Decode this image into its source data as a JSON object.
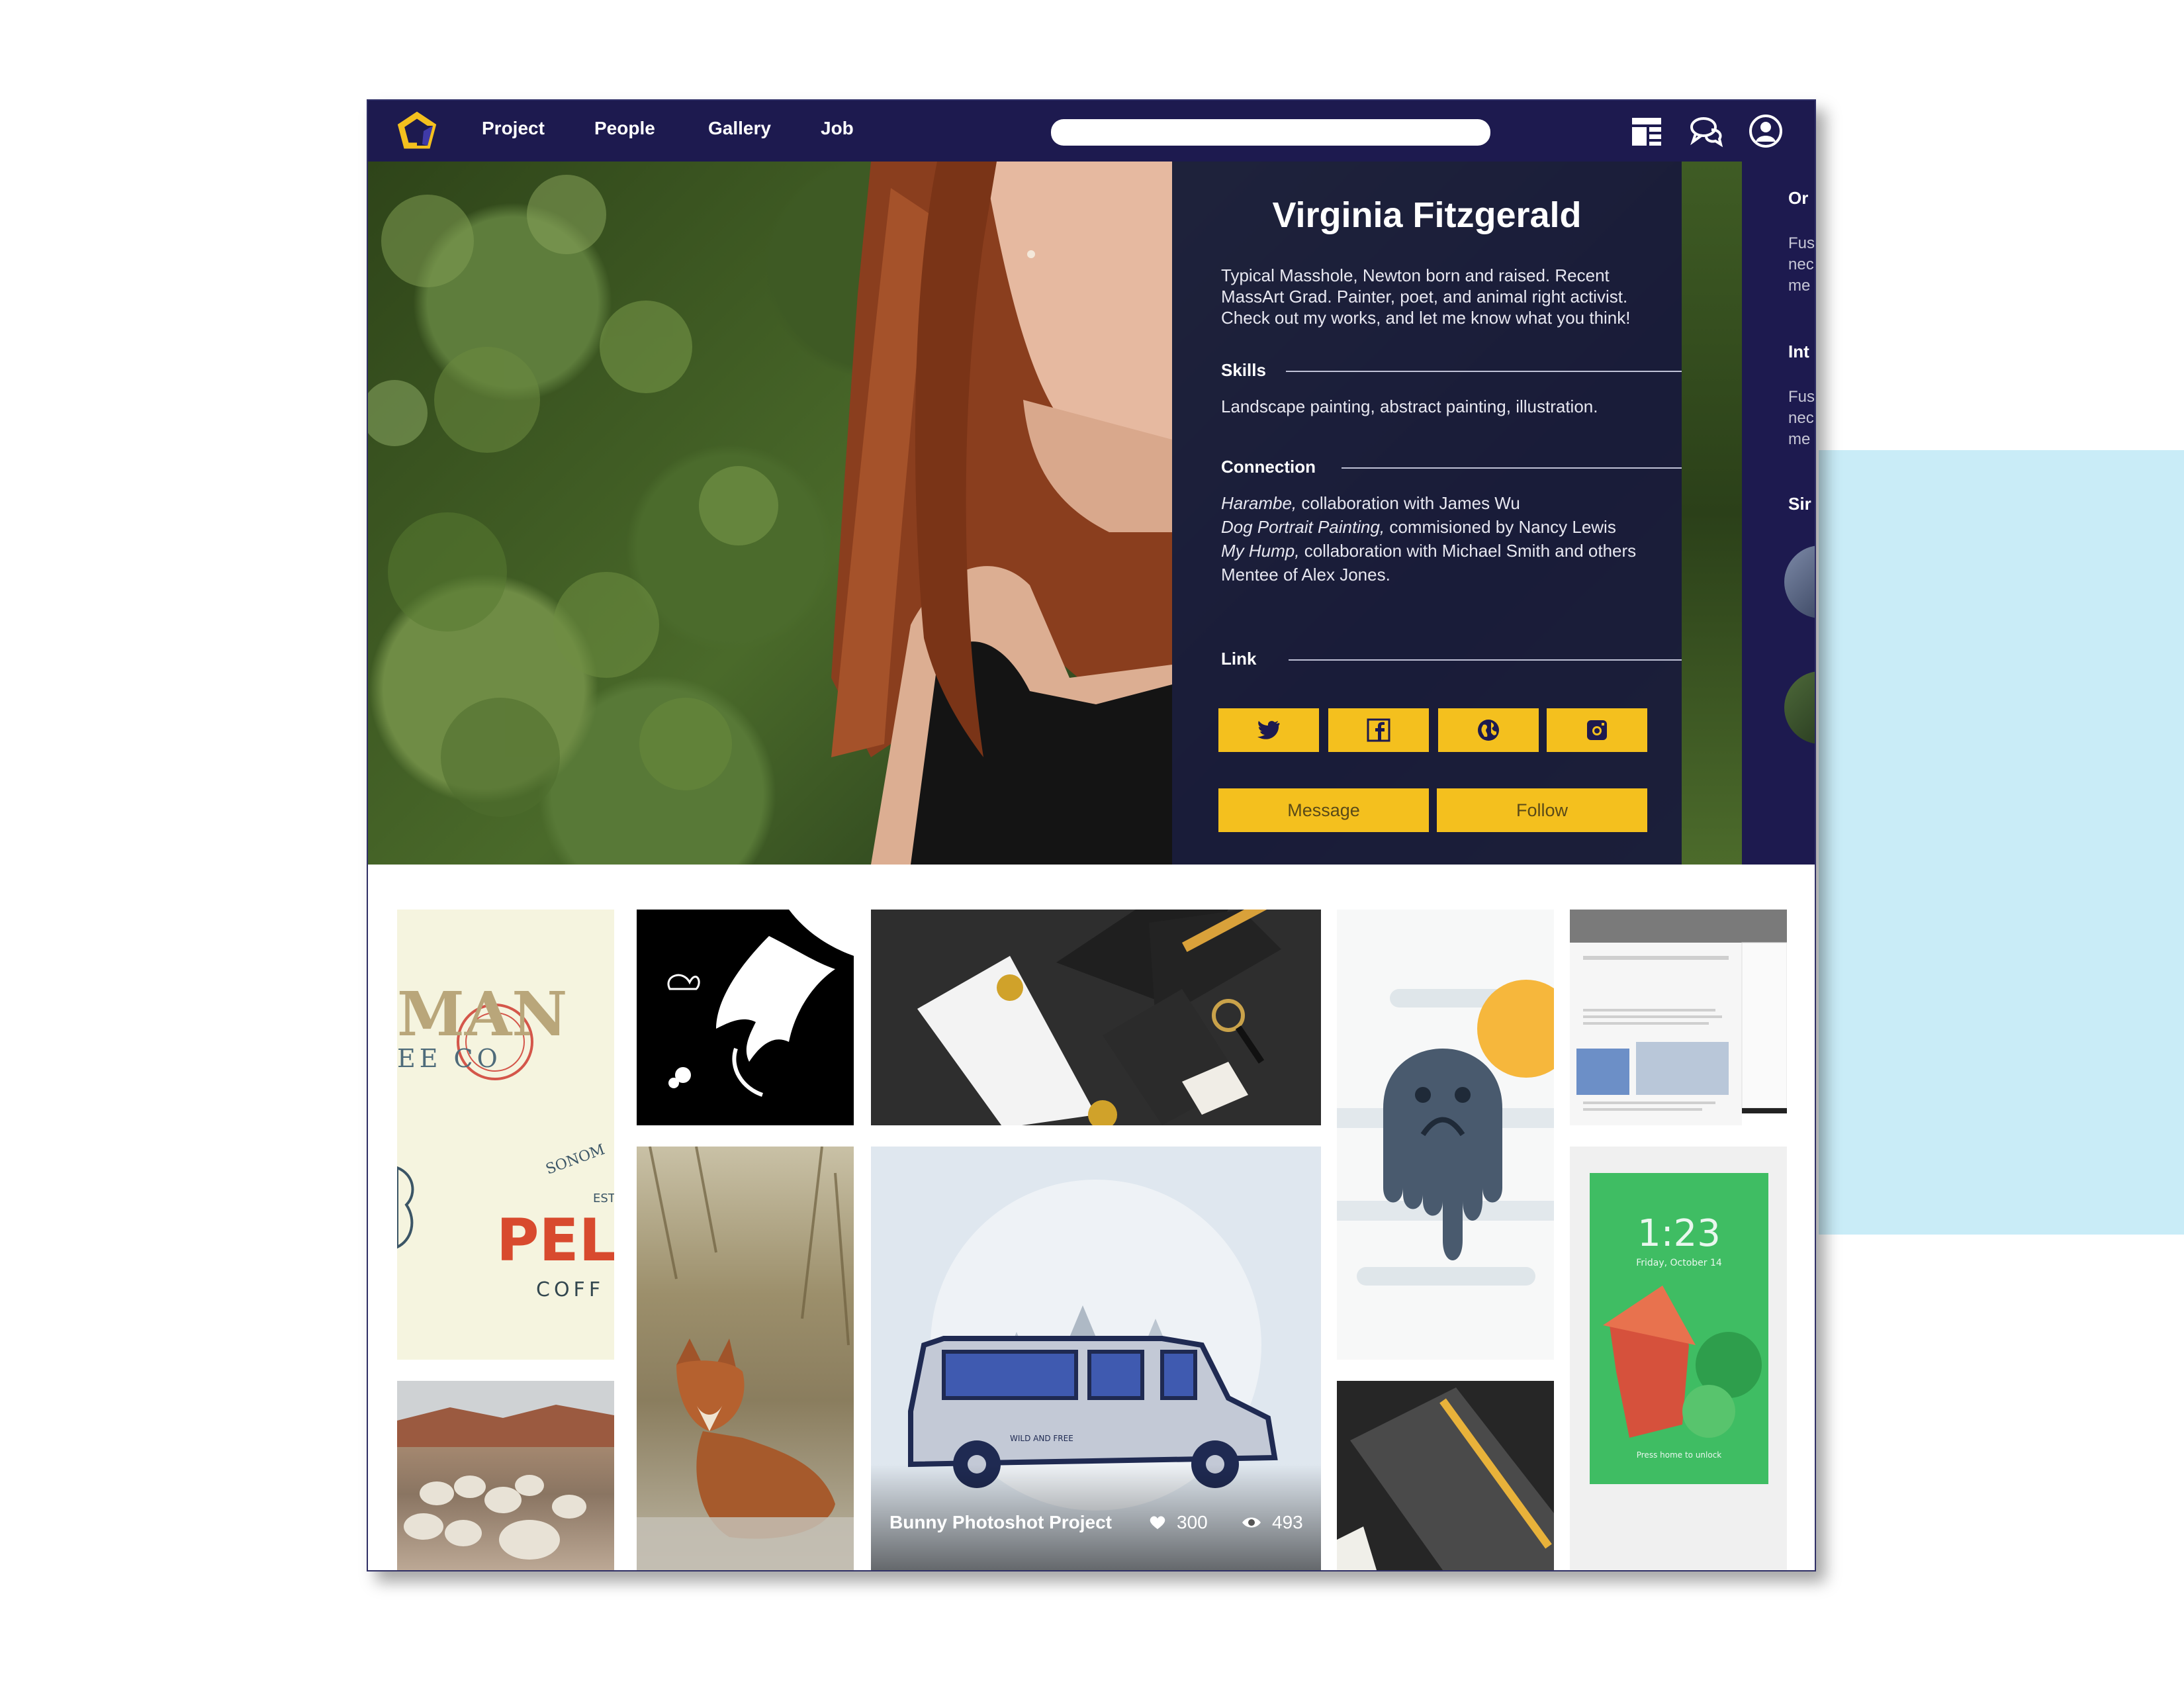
{
  "nav": {
    "links": [
      "Project",
      "People",
      "Gallery",
      "Job"
    ],
    "search_placeholder": ""
  },
  "profile": {
    "name": "Virginia Fitzgerald",
    "bio": "Typical Masshole, Newton born and raised. Recent MassArt Grad. Painter, poet, and animal right activist. Check out my works, and let me know what you think!",
    "skills_heading": "Skills",
    "skills": "Landscape painting, abstract painting, illustration.",
    "connection_heading": "Connection",
    "connections": [
      {
        "title": "Harambe,",
        "rest": " collaboration with James Wu"
      },
      {
        "title": "Dog Portrait Painting,",
        "rest": " commisioned by Nancy Lewis"
      },
      {
        "title": "My Hump,",
        "rest": " collaboration with Michael Smith and others"
      },
      {
        "title": "",
        "rest": "Mentee of Alex Jones."
      }
    ],
    "link_heading": "Link",
    "social": [
      "twitter-icon",
      "facebook-icon",
      "globe-icon",
      "instagram-icon"
    ],
    "message_label": "Message",
    "follow_label": "Follow"
  },
  "side_panel": {
    "headings": [
      "Or",
      "Int",
      "Sir"
    ],
    "texts": [
      [
        "Fus",
        "nec",
        "me"
      ],
      [
        "Fus",
        "nec",
        "me"
      ]
    ]
  },
  "gallery": {
    "featured": {
      "title": "Bunny Photoshot Project",
      "likes": "300",
      "views": "493"
    },
    "tile_text": {
      "brand_top": "MAN",
      "brand_sub": "EE CO",
      "brand_script": "SONOM",
      "brand_est": "EST",
      "brand_main": "PEL",
      "brand_coffee": "COFF",
      "van_text": "WILD AND FREE",
      "phone_time": "1:23",
      "phone_date": "Friday, October 14",
      "phone_unlock": "Press home to unlock"
    }
  },
  "colors": {
    "nav_bg": "#1d1a4f",
    "accent": "#f4c01e",
    "side_panel_bg": "#c9ecf7"
  }
}
